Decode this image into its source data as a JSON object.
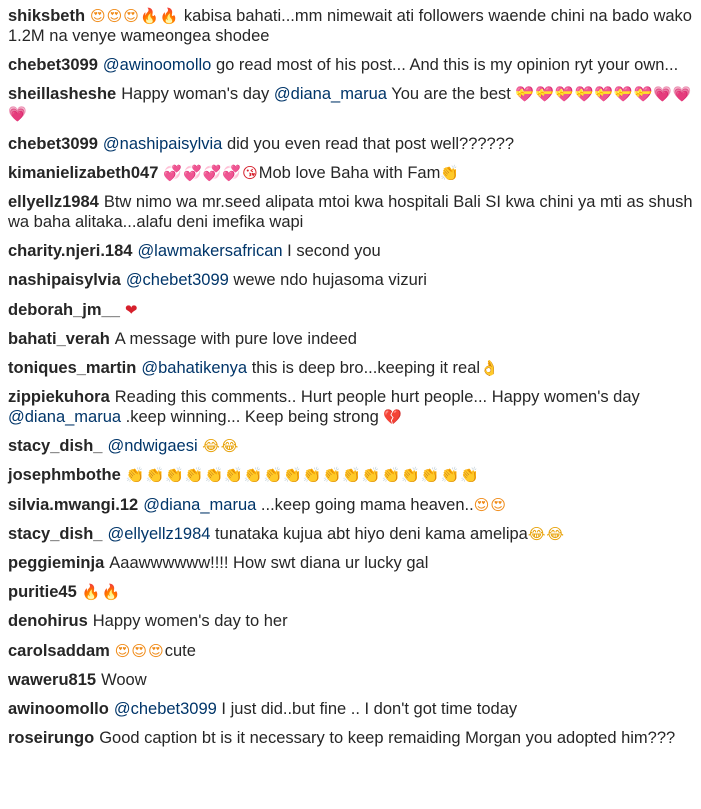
{
  "comments": [
    {
      "user": "shiksbeth",
      "pre": "",
      "mention": "",
      "emoji_pre": "😍😍😍🔥🔥",
      "text": " kabisa bahati...mm nimewait ati followers waende chini na bado wako 1.2M na venye wameongea shodee",
      "emoji_post": ""
    },
    {
      "user": "chebet3099",
      "pre": "",
      "mention": "@awinoomollo",
      "emoji_pre": "",
      "text": " go read most of his post... And this is my opinion ryt your own...",
      "emoji_post": ""
    },
    {
      "user": "sheillasheshe",
      "pre": "Happy woman's day ",
      "mention": "@diana_marua",
      "emoji_pre": "",
      "text": " You are the best ",
      "emoji_post": "💝💝💝💝💝💝💝💗💗💗"
    },
    {
      "user": "chebet3099",
      "pre": "",
      "mention": "@nashipaisylvia",
      "emoji_pre": "",
      "text": " did you even read that post well??????",
      "emoji_post": ""
    },
    {
      "user": "kimanielizabeth047",
      "pre": "",
      "mention": "",
      "emoji_pre": "💞💞💞💞😘",
      "text": "Mob love Baha with Fam",
      "emoji_post": "👏"
    },
    {
      "user": "ellyellz1984",
      "pre": "Btw nimo wa mr.seed alipata mtoi kwa hospitali Bali SI kwa chini ya mti as shush wa baha alitaka...alafu deni imefika wapi",
      "mention": "",
      "emoji_pre": "",
      "text": "",
      "emoji_post": ""
    },
    {
      "user": "charity.njeri.184",
      "pre": "",
      "mention": "@lawmakersafrican",
      "emoji_pre": "",
      "text": " I second you",
      "emoji_post": ""
    },
    {
      "user": "nashipaisylvia",
      "pre": "",
      "mention": "@chebet3099",
      "emoji_pre": "",
      "text": " wewe ndo hujasoma vizuri",
      "emoji_post": ""
    },
    {
      "user": "deborah_jm__",
      "pre": "",
      "mention": "",
      "emoji_pre": "",
      "text": "",
      "emoji_post": "❤"
    },
    {
      "user": "bahati_verah",
      "pre": "A message with pure love indeed",
      "mention": "",
      "emoji_pre": "",
      "text": "",
      "emoji_post": ""
    },
    {
      "user": "toniques_martin",
      "pre": "",
      "mention": "@bahatikenya",
      "emoji_pre": "",
      "text": " this is deep bro...keeping it real",
      "emoji_post": "👌"
    },
    {
      "user": "zippiekuhora",
      "pre": "Reading this comments.. Hurt people hurt people... Happy women's day ",
      "mention": "@diana_marua",
      "emoji_pre": "",
      "text": " .keep winning... Keep being strong ",
      "emoji_post": "💔"
    },
    {
      "user": "stacy_dish_",
      "pre": "",
      "mention": "@ndwigaesi",
      "emoji_pre": "",
      "text": " ",
      "emoji_post": "😂😂"
    },
    {
      "user": "josephmbothe",
      "pre": "",
      "mention": "",
      "emoji_pre": "",
      "text": "",
      "emoji_post": "👏👏👏👏👏👏👏👏👏👏👏👏👏👏👏👏👏👏"
    },
    {
      "user": "silvia.mwangi.12",
      "pre": "",
      "mention": "@diana_marua",
      "emoji_pre": "",
      "text": " ...keep going mama heaven..",
      "emoji_post": "😍😍"
    },
    {
      "user": "stacy_dish_",
      "pre": "",
      "mention": "@ellyellz1984",
      "emoji_pre": "",
      "text": " tunataka kujua abt hiyo deni kama amelipa",
      "emoji_post": "😂😂"
    },
    {
      "user": "peggieminja",
      "pre": "Aaawwwwww!!!! How swt diana ur lucky gal",
      "mention": "",
      "emoji_pre": "",
      "text": "",
      "emoji_post": ""
    },
    {
      "user": "puritie45",
      "pre": "",
      "mention": "",
      "emoji_pre": "",
      "text": "",
      "emoji_post": "🔥🔥"
    },
    {
      "user": "denohirus",
      "pre": "Happy women's day to her",
      "mention": "",
      "emoji_pre": "",
      "text": "",
      "emoji_post": ""
    },
    {
      "user": "carolsaddam",
      "pre": "",
      "mention": "",
      "emoji_pre": "😍😍😍",
      "text": "cute",
      "emoji_post": ""
    },
    {
      "user": "waweru815",
      "pre": "Woow",
      "mention": "",
      "emoji_pre": "",
      "text": "",
      "emoji_post": ""
    },
    {
      "user": "awinoomollo",
      "pre": "",
      "mention": "@chebet3099",
      "emoji_pre": "",
      "text": " I just did..but fine .. I don't got time today",
      "emoji_post": ""
    },
    {
      "user": "roseirungo",
      "pre": "Good caption bt is it necessary to keep remaiding Morgan you adopted him???",
      "mention": "",
      "emoji_pre": "",
      "text": "",
      "emoji_post": ""
    }
  ]
}
